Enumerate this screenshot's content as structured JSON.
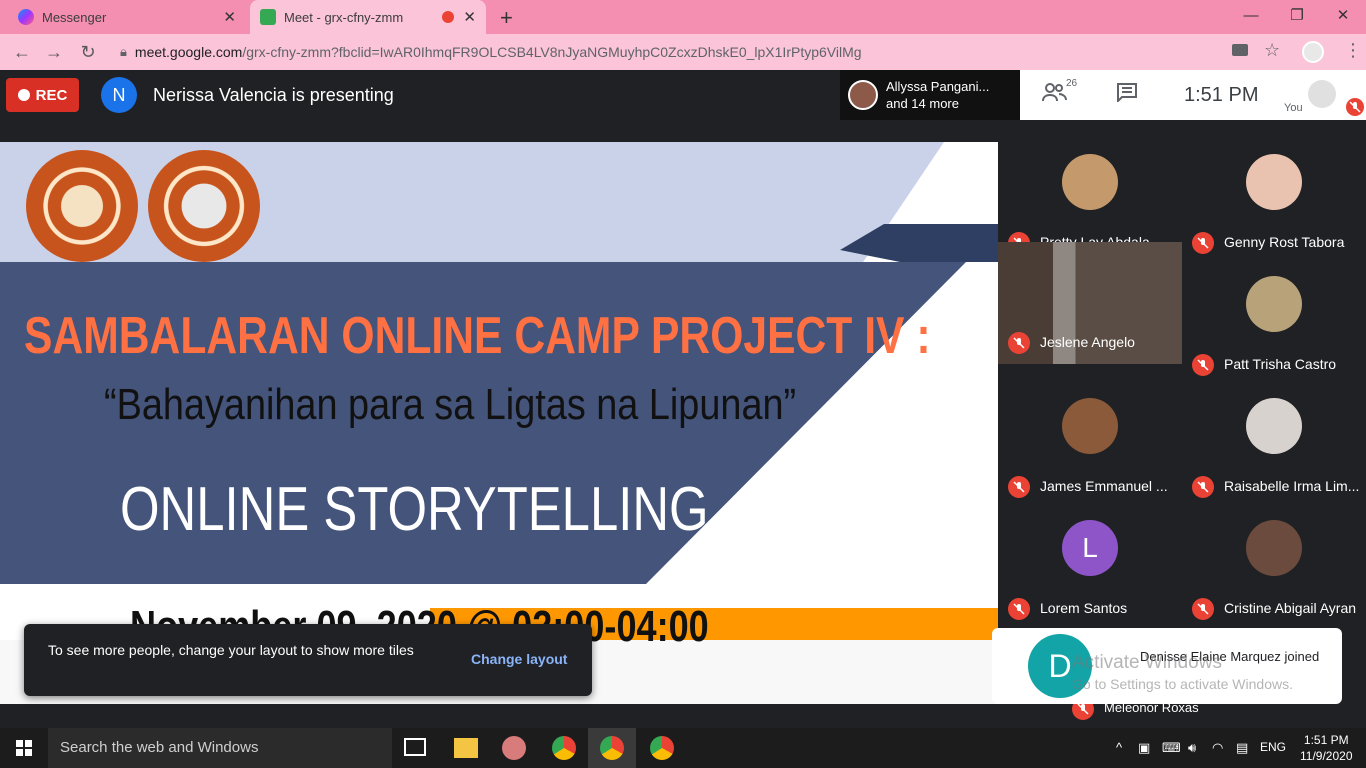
{
  "browser": {
    "tabs": [
      {
        "label": "Messenger"
      },
      {
        "label": "Meet - grx-cfny-zmm"
      }
    ],
    "url_domain": "meet.google.com",
    "url_rest": "/grx-cfny-zmm?fbclid=IwAR0IhmqFR9OLCSB4LV8nJyaNGMuyhpC0ZcxzDhskE0_lpX1IrPtyp6VilMg"
  },
  "meet": {
    "rec_label": "REC",
    "presenter_initial": "N",
    "presenting_text": "Nerissa Valencia is presenting",
    "people_chip_line1": "Allyssa Pangani...",
    "people_chip_line2": "and 14 more",
    "participant_count": "26",
    "clock": "1:51  PM",
    "you_label": "You"
  },
  "slide": {
    "title1": "SAMBALARAN ONLINE CAMP PROJECT IV :",
    "title2": "“Bahayanihan para sa Ligtas na Lipunan”",
    "title3": "ONLINE STORYTELLING",
    "title4": "November 09, 2020 @ 02:00-04:00"
  },
  "toast": {
    "message": "To see more people, change your layout to show more tiles",
    "action": "Change layout"
  },
  "participants": [
    {
      "name": "Pretty Lay Abdala",
      "color": "#c49a6c"
    },
    {
      "name": "Genny Rost Tabora",
      "color": "#e9c2b0"
    },
    {
      "name": "Jeslene Angelo",
      "color": "#5b4a40"
    },
    {
      "name": "Patt Trisha Castro",
      "color": "#b8a27a"
    },
    {
      "name": "James Emmanuel ...",
      "color": "#8a5a3a"
    },
    {
      "name": "Raisabelle Irma Lim...",
      "color": "#d8d2cf"
    },
    {
      "name": "Lorem Santos",
      "initial": "L",
      "color": "#8e55c9"
    },
    {
      "name": "Cristine Abigail Ayran",
      "color": "#6b4b3e"
    }
  ],
  "join_notice": {
    "initial": "D",
    "text": "Denisse Elaine Marquez joined"
  },
  "watermark": {
    "line1": "Activate Windows",
    "line2": "Go to Settings to activate Windows."
  },
  "peek_participant": "Meleonor Roxas",
  "taskbar": {
    "search_placeholder": "Search the web and Windows",
    "language": "ENG",
    "time": "1:51 PM",
    "date": "11/9/2020"
  }
}
